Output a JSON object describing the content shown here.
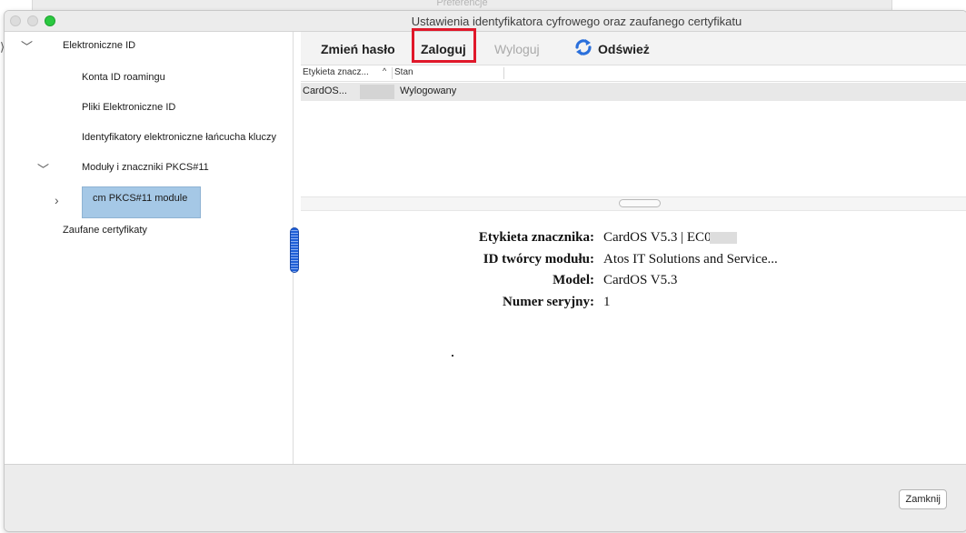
{
  "background_window": {
    "title": "Preferencje"
  },
  "window": {
    "title": "Ustawienia identyfikatora cyfrowego oraz zaufanego certyfikatu"
  },
  "tree": {
    "items": [
      {
        "label": "Elektroniczne ID",
        "expanded": true
      },
      {
        "label": "Konta ID roamingu"
      },
      {
        "label": "Pliki Elektroniczne ID"
      },
      {
        "label": "Identyfikatory elektroniczne łańcucha kluczy"
      },
      {
        "label": "Moduły i znaczniki PKCS#11",
        "expanded": true
      },
      {
        "label": "cm PKCS#11 module",
        "selected": true,
        "expanded": false
      },
      {
        "label": "Zaufane certyfikaty"
      }
    ]
  },
  "toolbar": {
    "change_password": "Zmień hasło",
    "login": "Zaloguj",
    "logout": "Wyloguj",
    "refresh": "Odśwież"
  },
  "table": {
    "columns": [
      "Etykieta znacz...",
      "Stan"
    ],
    "rows": [
      {
        "label": "CardOS...",
        "status": "Wylogowany"
      }
    ]
  },
  "details": {
    "token_label": {
      "label": "Etykieta znacznika:",
      "value": "CardOS V5.3 | EC00"
    },
    "manufacturer": {
      "label": "ID twórcy modułu:",
      "value": "Atos IT Solutions and Service..."
    },
    "model": {
      "label": "Model:",
      "value": "CardOS V5.3"
    },
    "serial": {
      "label": "Numer seryjny:",
      "value": "1"
    }
  },
  "footer": {
    "close": "Zamknij"
  },
  "colors": {
    "highlight": "#e0182a",
    "selection": "#a5c8e6",
    "accent": "#1f5fd8"
  }
}
